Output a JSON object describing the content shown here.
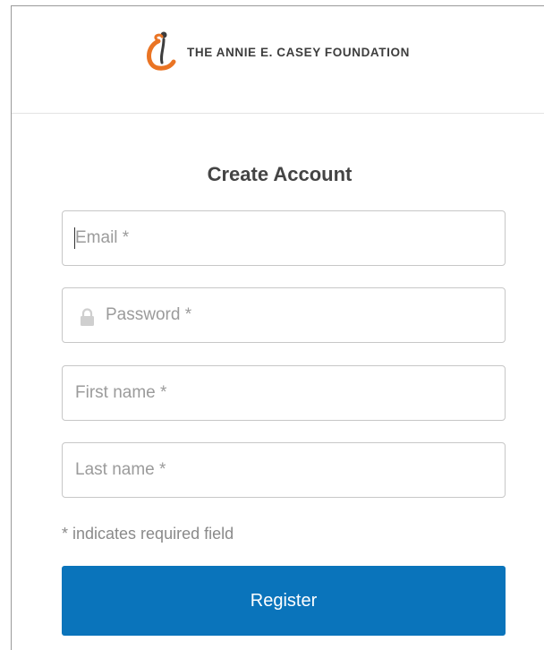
{
  "header": {
    "brand_name": "THE ANNIE E. CASEY FOUNDATION",
    "logo_icon": "casey-foundation-figure-icon",
    "logo_colors": {
      "orange": "#ea7424",
      "dark": "#3d3d3d"
    }
  },
  "form": {
    "title": "Create Account",
    "fields": {
      "email": {
        "placeholder": "Email *",
        "value": ""
      },
      "password": {
        "placeholder": "Password *",
        "value": "",
        "icon": "lock-icon"
      },
      "first_name": {
        "placeholder": "First name *",
        "value": ""
      },
      "last_name": {
        "placeholder": "Last name *",
        "value": ""
      }
    },
    "required_note": "* indicates required field",
    "submit_label": "Register",
    "submit_color": "#0a74bb"
  }
}
